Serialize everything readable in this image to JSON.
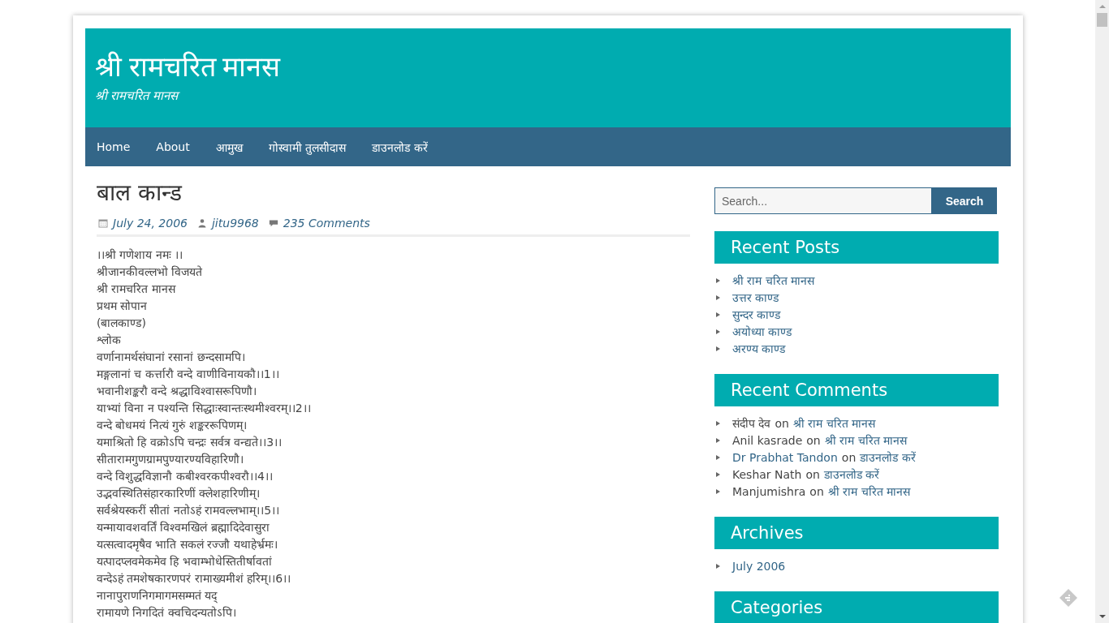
{
  "site": {
    "title": "श्री रामचरित मानस",
    "tagline": "श्री रामचरित मानस"
  },
  "nav": [
    {
      "label": "Home"
    },
    {
      "label": "About"
    },
    {
      "label": "आमुख"
    },
    {
      "label": "गोस्वामी तुलसीदास"
    },
    {
      "label": "डाउनलोड करें"
    }
  ],
  "post": {
    "title": "बाल कान्ड",
    "date": "July 24, 2006",
    "author": "jitu9968",
    "comments": "235 Comments",
    "lines": [
      "।।श्री गणेशाय नमः ।।",
      "श्रीजानकीवल्लभो विजयते",
      "श्री रामचरित मानस",
      "प्रथम सोपान",
      "(बालकाण्ड)",
      "श्लोक",
      "वर्णानामर्थसंघानां रसानां छन्दसामपि।",
      "मङ्गलानां च कर्त्तारौ वन्दे वाणीविनायकौ।।1।।",
      "भवानीशङ्करौ वन्दे श्रद्धाविश्वासरूपिणौ।",
      "याभ्यां विना न पश्यन्ति सिद्धाःस्वान्तःस्थमीश्वरम्।।2।।",
      "वन्दे बोधमयं नित्यं गुरुं शङ्कररूपिणम्।",
      "यमाश्रितो हि वक्रोऽपि चन्द्रः सर्वत्र वन्द्यते।।3।।",
      "सीतारामगुणग्रामपुण्यारण्यविहारिणौ।",
      "वन्दे विशुद्धविज्ञानौ कबीश्वरकपीश्वरौ।।4।।",
      "उद्भवस्थितिसंहारकारिणीं क्लेशहारिणीम्।",
      "सर्वश्रेयस्करीं सीतां नतोऽहं रामवल्लभाम्।।5।।",
      "यन्मायावशवर्तिं विश्वमखिलं ब्रह्मादिदेवासुरा",
      "यत्सत्वादमृषैव भाति सकलं रज्जौ यथाहेर्भ्रमः।",
      "यत्पादप्लवमेकमेव हि भवाम्भोधेस्तितीर्षावतां",
      "वन्देऽहं तमशेषकारणपरं रामाख्यमीशं हरिम्।।6।।",
      "नानापुराणनिगमागमसम्मतं यद्",
      "रामायणे निगदितं क्वचिदन्यतोऽपि।"
    ]
  },
  "search": {
    "placeholder": "Search...",
    "button": "Search"
  },
  "widgets": [
    {
      "title": "Recent Posts",
      "kind": "links",
      "items": [
        {
          "text": "श्री राम चरित मानस"
        },
        {
          "text": "उत्तर काण्ड"
        },
        {
          "text": "सुन्दर काण्ड"
        },
        {
          "text": "अयोध्या काण्ड"
        },
        {
          "text": "अरण्य काण्ड"
        }
      ]
    },
    {
      "title": "Recent Comments",
      "kind": "comments",
      "items": [
        {
          "author": "संदीप देव",
          "author_link": false,
          "on": "on",
          "post": "श्री राम चरित मानस"
        },
        {
          "author": "Anil kasrade",
          "author_link": false,
          "on": "on",
          "post": "श्री राम चरित मानस"
        },
        {
          "author": "Dr Prabhat Tandon",
          "author_link": true,
          "on": "on",
          "post": "डाउनलोड करें"
        },
        {
          "author": "Keshar Nath",
          "author_link": false,
          "on": "on",
          "post": "डाउनलोड करें"
        },
        {
          "author": "Manjumishra",
          "author_link": false,
          "on": "on",
          "post": "श्री राम चरित मानस"
        }
      ]
    },
    {
      "title": "Archives",
      "kind": "links",
      "items": [
        {
          "text": "July 2006"
        }
      ]
    },
    {
      "title": "Categories"
    }
  ]
}
